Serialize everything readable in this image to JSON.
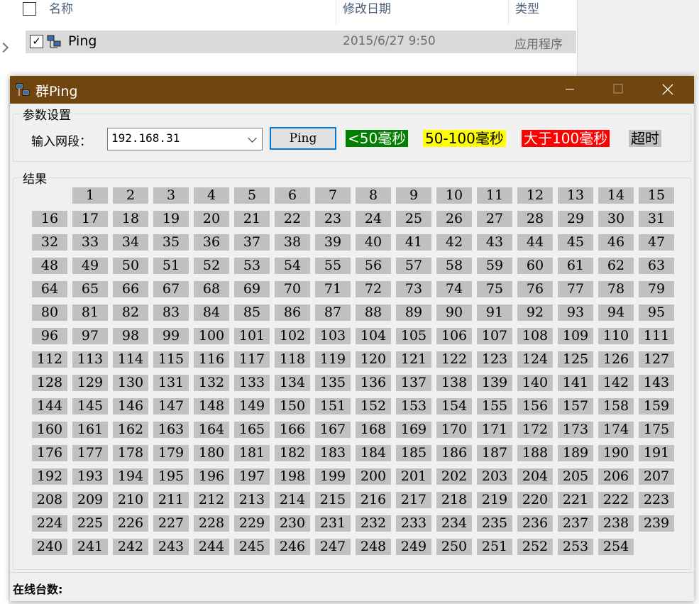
{
  "explorer": {
    "col_name": "名称",
    "col_date": "修改日期",
    "col_type": "类型",
    "file": {
      "name": "Ping",
      "checked": "✓",
      "date": "2015/6/27 9:50",
      "type": "应用程序"
    }
  },
  "window": {
    "title": "群Ping",
    "params_group": "参数设置",
    "input_label": "输入网段：",
    "segment_value": "192.168.31",
    "ping_button": "Ping",
    "results_group": "结果",
    "online_label": "在线台数:",
    "legend": [
      {
        "label": "<50毫秒",
        "bg": "#008000",
        "fg": "#ffffff"
      },
      {
        "label": "50-100毫秒",
        "bg": "#ffff00",
        "fg": "#000000"
      },
      {
        "label": "大于100毫秒",
        "bg": "#ff0000",
        "fg": "#ffffff"
      },
      {
        "label": "超时",
        "bg": "#c0c0c0",
        "fg": "#000000"
      }
    ],
    "host_count": 254
  },
  "colors": {
    "titlebar": "#704510",
    "cell_timeout": "#c0c0c0",
    "accent": "#0078d7"
  }
}
